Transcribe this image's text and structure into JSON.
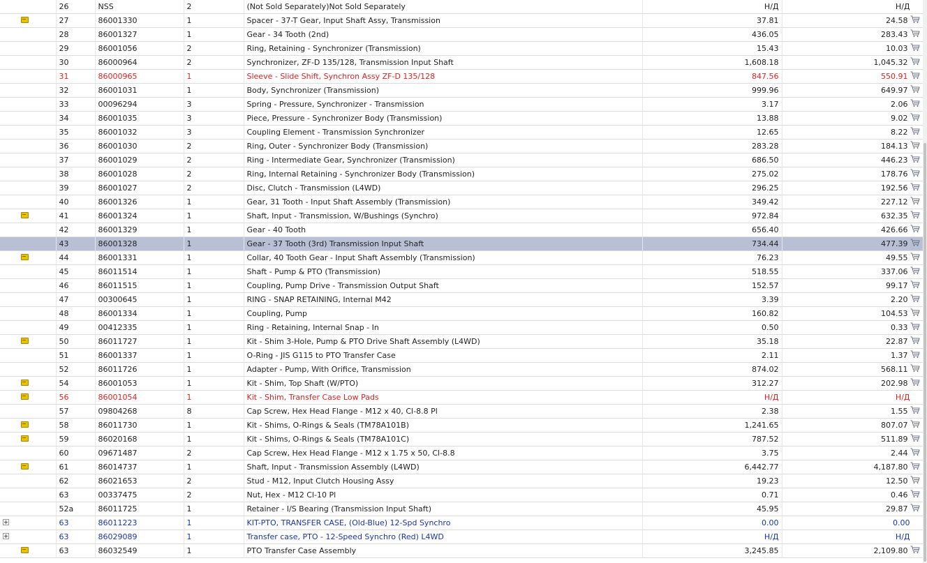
{
  "rows": [
    {
      "pos": "26",
      "part": "NSS",
      "qty": "2",
      "desc": "(Not Sold Separately)Not Sold Separately",
      "price": "Н/Д",
      "price2": "Н/Д",
      "icon": "none",
      "style": "normal",
      "cart": false
    },
    {
      "pos": "27",
      "part": "86001330",
      "qty": "1",
      "desc": "Spacer - 37-T Gear, Input Shaft Assy, Transmission",
      "price": "37.81",
      "price2": "24.58",
      "icon": "note",
      "style": "normal",
      "cart": true
    },
    {
      "pos": "28",
      "part": "86001327",
      "qty": "1",
      "desc": "Gear - 34 Tooth (2nd)",
      "price": "436.05",
      "price2": "283.43",
      "icon": "none",
      "style": "normal",
      "cart": true
    },
    {
      "pos": "29",
      "part": "86001056",
      "qty": "2",
      "desc": "Ring, Retaining - Synchronizer (Transmission)",
      "price": "15.43",
      "price2": "10.03",
      "icon": "none",
      "style": "normal",
      "cart": true
    },
    {
      "pos": "30",
      "part": "86000964",
      "qty": "2",
      "desc": "Synchronizer, ZF-D 135/128, Transmission Input Shaft",
      "price": "1,608.18",
      "price2": "1,045.32",
      "icon": "none",
      "style": "normal",
      "cart": true
    },
    {
      "pos": "31",
      "part": "86000965",
      "qty": "1",
      "desc": "Sleeve - Slide Shift, Synchron Assy ZF-D 135/128",
      "price": "847.56",
      "price2": "550.91",
      "icon": "none",
      "style": "red",
      "cart": true
    },
    {
      "pos": "32",
      "part": "86001031",
      "qty": "1",
      "desc": "Body, Synchronizer (Transmission)",
      "price": "999.96",
      "price2": "649.97",
      "icon": "none",
      "style": "normal",
      "cart": true
    },
    {
      "pos": "33",
      "part": "00096294",
      "qty": "3",
      "desc": "Spring - Pressure, Synchronizer - Transmission",
      "price": "3.17",
      "price2": "2.06",
      "icon": "none",
      "style": "normal",
      "cart": true
    },
    {
      "pos": "34",
      "part": "86001035",
      "qty": "3",
      "desc": "Piece, Pressure - Synchronizer Body (Transmission)",
      "price": "13.88",
      "price2": "9.02",
      "icon": "none",
      "style": "normal",
      "cart": true
    },
    {
      "pos": "35",
      "part": "86001032",
      "qty": "3",
      "desc": "Coupling Element - Transmission Synchronizer",
      "price": "12.65",
      "price2": "8.22",
      "icon": "none",
      "style": "normal",
      "cart": true
    },
    {
      "pos": "36",
      "part": "86001030",
      "qty": "2",
      "desc": "Ring, Outer - Synchronizer Body (Transmission)",
      "price": "283.28",
      "price2": "184.13",
      "icon": "none",
      "style": "normal",
      "cart": true
    },
    {
      "pos": "37",
      "part": "86001029",
      "qty": "2",
      "desc": "Ring - Intermediate Gear, Synchronizer (Transmission)",
      "price": "686.50",
      "price2": "446.23",
      "icon": "none",
      "style": "normal",
      "cart": true
    },
    {
      "pos": "38",
      "part": "86001028",
      "qty": "2",
      "desc": "Ring, Internal Retaining - Synchronizer Body (Transmission)",
      "price": "275.02",
      "price2": "178.76",
      "icon": "none",
      "style": "normal",
      "cart": true
    },
    {
      "pos": "39",
      "part": "86001027",
      "qty": "2",
      "desc": "Disc, Clutch - Transmission (L4WD)",
      "price": "296.25",
      "price2": "192.56",
      "icon": "none",
      "style": "normal",
      "cart": true
    },
    {
      "pos": "40",
      "part": "86001326",
      "qty": "1",
      "desc": "Gear, 31 Tooth - Input Shaft Assembly (Transmission)",
      "price": "349.42",
      "price2": "227.12",
      "icon": "none",
      "style": "normal",
      "cart": true
    },
    {
      "pos": "41",
      "part": "86001324",
      "qty": "1",
      "desc": "Shaft, Input - Transmission, W/Bushings (Synchro)",
      "price": "972.84",
      "price2": "632.35",
      "icon": "note",
      "style": "normal",
      "cart": true
    },
    {
      "pos": "42",
      "part": "86001329",
      "qty": "1",
      "desc": "Gear - 40 Tooth",
      "price": "656.40",
      "price2": "426.66",
      "icon": "none",
      "style": "normal",
      "cart": true
    },
    {
      "pos": "43",
      "part": "86001328",
      "qty": "1",
      "desc": "Gear - 37 Tooth (3rd) Transmission Input Shaft",
      "price": "734.44",
      "price2": "477.39",
      "icon": "none",
      "style": "selected",
      "cart": true
    },
    {
      "pos": "44",
      "part": "86001331",
      "qty": "1",
      "desc": "Collar, 40 Tooth Gear - Input Shaft Assembly (Transmission)",
      "price": "76.23",
      "price2": "49.55",
      "icon": "note",
      "style": "normal",
      "cart": true
    },
    {
      "pos": "45",
      "part": "86011514",
      "qty": "1",
      "desc": "Shaft - Pump & PTO (Transmission)",
      "price": "518.55",
      "price2": "337.06",
      "icon": "none",
      "style": "normal",
      "cart": true
    },
    {
      "pos": "46",
      "part": "86011515",
      "qty": "1",
      "desc": "Coupling, Pump Drive - Transmission Output Shaft",
      "price": "152.57",
      "price2": "99.17",
      "icon": "none",
      "style": "normal",
      "cart": true
    },
    {
      "pos": "47",
      "part": "00300645",
      "qty": "1",
      "desc": "RING - SNAP RETAINING, Internal M42",
      "price": "3.39",
      "price2": "2.20",
      "icon": "none",
      "style": "normal",
      "cart": true
    },
    {
      "pos": "48",
      "part": "86001334",
      "qty": "1",
      "desc": "Coupling, Pump",
      "price": "160.82",
      "price2": "104.53",
      "icon": "none",
      "style": "normal",
      "cart": true
    },
    {
      "pos": "49",
      "part": "00412335",
      "qty": "1",
      "desc": "Ring - Retaining, Internal Snap - In",
      "price": "0.50",
      "price2": "0.33",
      "icon": "none",
      "style": "normal",
      "cart": true
    },
    {
      "pos": "50",
      "part": "86011727",
      "qty": "1",
      "desc": "Kit - Shim 3-Hole, Pump & PTO Drive Shaft Assembly (L4WD)",
      "price": "35.18",
      "price2": "22.87",
      "icon": "note",
      "style": "normal",
      "cart": true
    },
    {
      "pos": "51",
      "part": "86001337",
      "qty": "1",
      "desc": "O-Ring - JIS G115 to PTO Transfer Case",
      "price": "2.11",
      "price2": "1.37",
      "icon": "none",
      "style": "normal",
      "cart": true
    },
    {
      "pos": "52",
      "part": "86011726",
      "qty": "1",
      "desc": "Adapter - Pump, With Orifice, Transmission",
      "price": "874.02",
      "price2": "568.11",
      "icon": "none",
      "style": "normal",
      "cart": true
    },
    {
      "pos": "54",
      "part": "86001053",
      "qty": "1",
      "desc": "Kit - Shim, Top Shaft (W/PTO)",
      "price": "312.27",
      "price2": "202.98",
      "icon": "note",
      "style": "normal",
      "cart": true
    },
    {
      "pos": "56",
      "part": "86001054",
      "qty": "1",
      "desc": "Kit - Shim, Transfer Case Low Pads",
      "price": "Н/Д",
      "price2": "Н/Д",
      "icon": "note",
      "style": "red",
      "cart": false
    },
    {
      "pos": "57",
      "part": "09804268",
      "qty": "8",
      "desc": "Cap Screw, Hex Head Flange - M12 x 40, Cl-8.8 Pl",
      "price": "2.38",
      "price2": "1.55",
      "icon": "none",
      "style": "normal",
      "cart": true
    },
    {
      "pos": "58",
      "part": "86011730",
      "qty": "1",
      "desc": "Kit - Shims, O-Rings & Seals (TM78A101B)",
      "price": "1,241.65",
      "price2": "807.07",
      "icon": "note",
      "style": "normal",
      "cart": true
    },
    {
      "pos": "59",
      "part": "86020168",
      "qty": "1",
      "desc": "Kit - Shims, O-Rings & Seals (TM78A101C)",
      "price": "787.52",
      "price2": "511.89",
      "icon": "note",
      "style": "normal",
      "cart": true
    },
    {
      "pos": "60",
      "part": "09671487",
      "qty": "2",
      "desc": "Cap Screw, Hex Head Flange - M12 x 1.75 x 50, Cl-8.8",
      "price": "3.75",
      "price2": "2.44",
      "icon": "none",
      "style": "normal",
      "cart": true
    },
    {
      "pos": "61",
      "part": "86014737",
      "qty": "1",
      "desc": "Shaft, Input - Transmission Assembly (L4WD)",
      "price": "6,442.77",
      "price2": "4,187.80",
      "icon": "note",
      "style": "normal",
      "cart": true
    },
    {
      "pos": "62",
      "part": "86021653",
      "qty": "2",
      "desc": "Stud - M12, Input Clutch Housing Assy",
      "price": "19.23",
      "price2": "12.50",
      "icon": "none",
      "style": "normal",
      "cart": true
    },
    {
      "pos": "63",
      "part": "00337475",
      "qty": "2",
      "desc": "Nut, Hex - M12 Cl-10 Pl",
      "price": "0.71",
      "price2": "0.46",
      "icon": "none",
      "style": "normal",
      "cart": true
    },
    {
      "pos": "52a",
      "part": "86011725",
      "qty": "1",
      "desc": "Retainer - I/S Bearing (Transmission Input Shaft)",
      "price": "45.95",
      "price2": "29.87",
      "icon": "none",
      "style": "normal",
      "cart": true
    },
    {
      "pos": "63",
      "part": "86011223",
      "qty": "1",
      "desc": "KIT-PTO, TRANSFER CASE, (Old-Blue) 12-Spd Synchro",
      "price": "0.00",
      "price2": "0.00",
      "icon": "expand",
      "style": "blue",
      "cart": false
    },
    {
      "pos": "63",
      "part": "86029089",
      "qty": "1",
      "desc": "Transfer case, PTO - 12-Speed Synchro (Red) L4WD",
      "price": "Н/Д",
      "price2": "Н/Д",
      "icon": "expand",
      "style": "blue",
      "cart": false
    },
    {
      "pos": "63",
      "part": "86032549",
      "qty": "1",
      "desc": "PTO Transfer Case Assembly",
      "price": "3,245.85",
      "price2": "2,109.80",
      "icon": "note",
      "style": "normal",
      "cart": true
    }
  ]
}
